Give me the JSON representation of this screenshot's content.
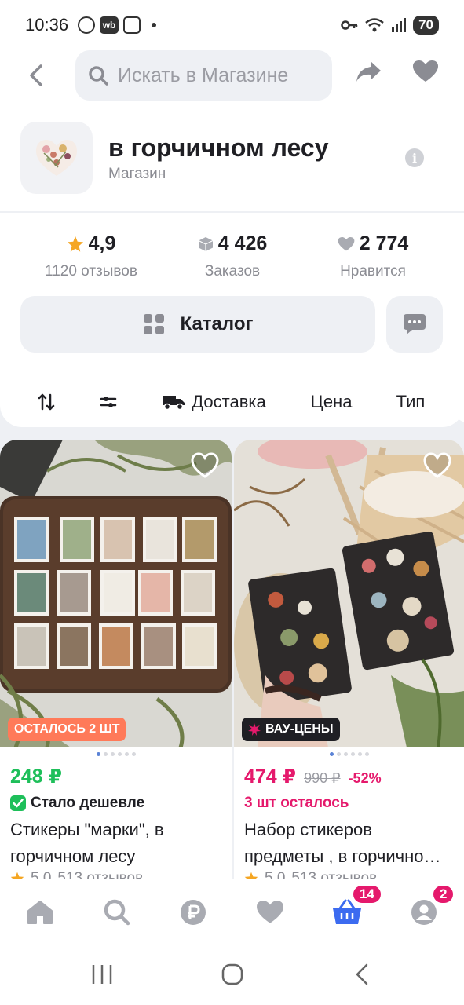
{
  "status_bar": {
    "time": "10:36",
    "wb_label": "wb",
    "battery": "70"
  },
  "search": {
    "placeholder": "Искать в Магазине"
  },
  "shop": {
    "name": "в горчичном лесу",
    "type": "Магазин"
  },
  "stats": [
    {
      "value": "4,9",
      "label": "1120 отзывов",
      "icon": "star-icon",
      "color": "#f5a623"
    },
    {
      "value": "4 426",
      "label": "Заказов",
      "icon": "box-icon",
      "color": "#a9abb2"
    },
    {
      "value": "2 774",
      "label": "Нравится",
      "icon": "heart-icon",
      "color": "#a9abb2"
    }
  ],
  "catalog": {
    "label": "Каталог"
  },
  "filters": {
    "delivery": "Доставка",
    "price": "Цена",
    "type": "Тип"
  },
  "products": [
    {
      "badge": "ОСТАЛОСЬ 2 ШТ",
      "price": "248 ₽",
      "promo": "Стало дешевле",
      "title": "Стикеры \"марки\", в горчичном лесу",
      "rating": "5,0",
      "reviews": "513 отзывов"
    },
    {
      "badge": "ВАУ-ЦЕНЫ",
      "price": "474 ₽",
      "old_price": "990 ₽",
      "discount": "-52%",
      "promo": "3 шт осталось",
      "title": "Набор стикеров предметы , в горчично…",
      "rating": "5,0",
      "reviews": "513 отзывов"
    }
  ],
  "nav": {
    "cart_count": "14",
    "profile_count": "2"
  },
  "colors": {
    "accent_pink": "#e5196c",
    "green": "#1ebf5a",
    "cart_blue": "#3c6bf0"
  }
}
